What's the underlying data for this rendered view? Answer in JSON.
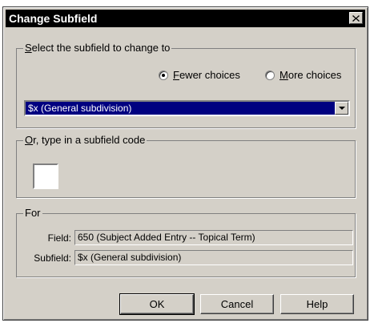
{
  "dialog": {
    "title": "Change Subfield",
    "close_glyph": "✕"
  },
  "select_group": {
    "legend_mnemonic": "S",
    "legend_rest": "elect the subfield to change to",
    "radio_fewer": {
      "mnemonic": "F",
      "rest": "ewer choices",
      "checked": true
    },
    "radio_more": {
      "mnemonic": "M",
      "rest": "ore choices",
      "checked": false
    },
    "combo_value": "$x (General subdivision)"
  },
  "type_group": {
    "legend_mnemonic": "O",
    "legend_rest": "r, type in a subfield code",
    "input_value": ""
  },
  "for_group": {
    "legend": "For",
    "field_label": "Field:",
    "field_value": "650 (Subject Added Entry -- Topical Term)",
    "subfield_label": "Subfield:",
    "subfield_value": "$x (General subdivision)"
  },
  "buttons": {
    "ok": "OK",
    "cancel": "Cancel",
    "help": "Help"
  },
  "colors": {
    "face": "#d4d0c8",
    "selection": "#000080",
    "titlebar": "#000000"
  }
}
